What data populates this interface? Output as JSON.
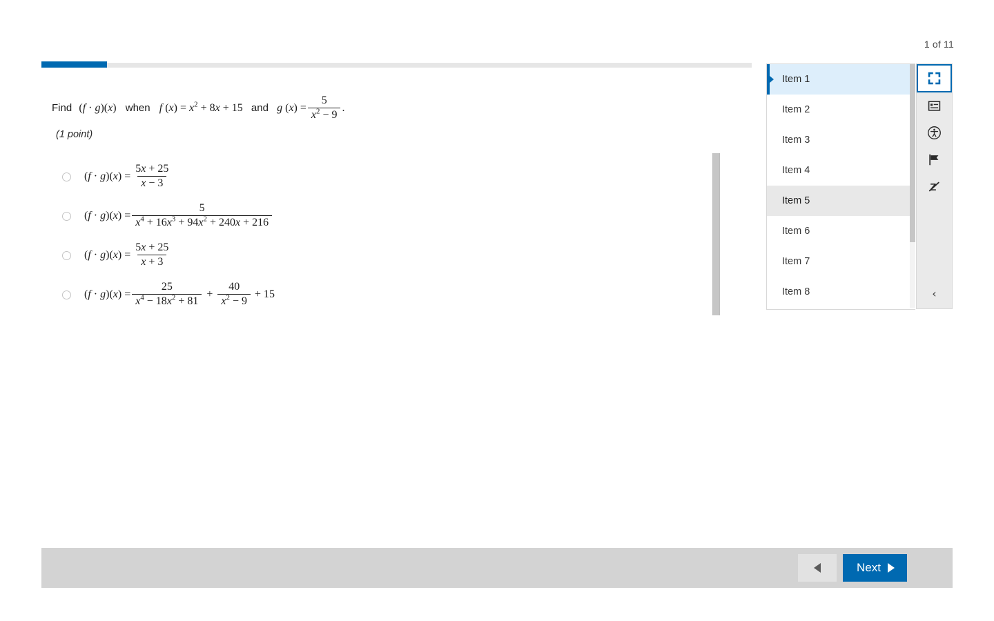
{
  "header": {
    "page_counter": "1 of 11"
  },
  "progress": {
    "percent": 9.2,
    "fill_color": "#0069b1",
    "track_color": "#e6e6e6"
  },
  "question": {
    "prompt_prefix": "Find",
    "prompt_expr1": "(f · g)(x)",
    "prompt_mid": "when",
    "prompt_f": "f (x) = x² + 8x + 15",
    "prompt_and": "and",
    "prompt_g_lead": "g (x) =",
    "prompt_g_num": "5",
    "prompt_g_den": "x² − 9",
    "prompt_period": ".",
    "points_label": "(1 point)",
    "options": [
      {
        "id": "option-a",
        "lead": "(f · g)(x) =",
        "numerator": "5x + 25",
        "denominator": "x − 3",
        "tail": "",
        "selected": false
      },
      {
        "id": "option-b",
        "lead": "(f · g)(x) =",
        "numerator": "5",
        "denominator": "x⁴ + 16x³ + 94x² + 240x + 216",
        "tail": "",
        "selected": false
      },
      {
        "id": "option-c",
        "lead": "(f · g)(x) =",
        "numerator": "5x + 25",
        "denominator": "x + 3",
        "tail": "",
        "selected": false
      },
      {
        "id": "option-d",
        "lead": "(f · g)(x) =",
        "numerator": "25",
        "denominator": "x⁴ − 18x² + 81",
        "numerator2": "40",
        "denominator2": "x² − 9",
        "tail": "+ 15",
        "selected": false
      }
    ]
  },
  "navigator": {
    "items": [
      {
        "label": "Item 1",
        "state": "active"
      },
      {
        "label": "Item 2",
        "state": "normal"
      },
      {
        "label": "Item 3",
        "state": "normal"
      },
      {
        "label": "Item 4",
        "state": "normal"
      },
      {
        "label": "Item 5",
        "state": "hovered"
      },
      {
        "label": "Item 6",
        "state": "normal"
      },
      {
        "label": "Item 7",
        "state": "normal"
      },
      {
        "label": "Item 8",
        "state": "normal"
      }
    ]
  },
  "tools": [
    {
      "name": "fullscreen-icon",
      "label": "Fullscreen",
      "active": true
    },
    {
      "name": "reference-panel-icon",
      "label": "Reference",
      "active": false
    },
    {
      "name": "accessibility-icon",
      "label": "Accessibility",
      "active": false
    },
    {
      "name": "flag-icon",
      "label": "Flag item",
      "active": false
    },
    {
      "name": "eliminate-answer-icon",
      "label": "Eliminate answer",
      "active": false
    }
  ],
  "tool_collapse": {
    "label": "‹"
  },
  "footer": {
    "prev_label": "",
    "next_label": "Next",
    "next_color": "#0069b1",
    "bar_color": "#d3d3d3"
  }
}
